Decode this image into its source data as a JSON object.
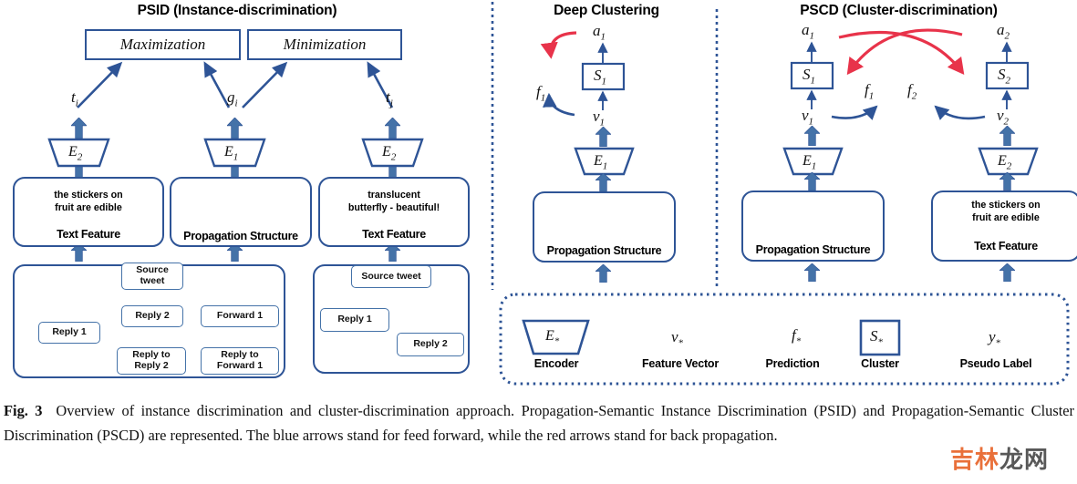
{
  "figure": {
    "number": "Fig. 3",
    "caption": "Overview of instance discrimination and cluster-discrimination approach. Propagation-Semantic Instance Discrimination (PSID) and Propagation-Semantic Cluster Discrimination (PSCD) are represented. The blue arrows stand for feed forward, while the red arrows stand for back propagation.",
    "watermark": {
      "orange": "吉林",
      "gray": "龙网"
    }
  },
  "colors": {
    "blue": "#2e5496",
    "blue_arrow": "#4472a8",
    "green_arrow": "#9bc987",
    "node_green": "#c6dfb0",
    "red": "#e8334a",
    "bubble_pink": "#e8607f",
    "text": "#111111"
  },
  "panels": {
    "psid": {
      "title": "PSID (Instance-discrimination)",
      "objectives": [
        {
          "label": "Maximization"
        },
        {
          "label": "Minimization"
        }
      ],
      "vectors": [
        {
          "sym": "t",
          "sub": "i"
        },
        {
          "sym": "g",
          "sub": "i"
        },
        {
          "sym": "t",
          "sub": "j"
        }
      ],
      "encoders": [
        {
          "sym": "E",
          "sub": "2"
        },
        {
          "sym": "E",
          "sub": "1"
        },
        {
          "sym": "E",
          "sub": "2"
        }
      ],
      "features": [
        {
          "kind": "text",
          "label": "Text Feature",
          "bubble": [
            "the stickers on",
            "fruit are edible"
          ]
        },
        {
          "kind": "graph",
          "label": "Propagation Structure"
        },
        {
          "kind": "text",
          "label": "Text Feature",
          "bubble": [
            "translucent",
            "butterfly - beautiful!"
          ]
        }
      ],
      "tree_left": {
        "nodes": [
          {
            "text": "Source\ntweet"
          },
          {
            "text": "Reply 1"
          },
          {
            "text": "Reply 2"
          },
          {
            "text": "Forward 1"
          },
          {
            "text": "Reply to\nReply 2"
          },
          {
            "text": "Reply to\nForward 1"
          }
        ]
      },
      "tree_right": {
        "nodes": [
          {
            "text": "Source tweet"
          },
          {
            "text": "Reply 1"
          },
          {
            "text": "Reply 2"
          }
        ]
      }
    },
    "deep_clustering": {
      "title": "Deep Clustering",
      "pseudo_label": {
        "sym": "a",
        "sub": "1"
      },
      "cluster": {
        "sym": "S",
        "sub": "1"
      },
      "prediction": {
        "sym": "f",
        "sub": "1"
      },
      "feature_vector": {
        "sym": "v",
        "sub": "1"
      },
      "encoder": {
        "sym": "E",
        "sub": "1"
      },
      "feature_label": "Propagation Structure"
    },
    "pscd": {
      "title": "PSCD (Cluster-discrimination)",
      "branches": [
        {
          "pseudo_label": {
            "sym": "a",
            "sub": "1"
          },
          "cluster": {
            "sym": "S",
            "sub": "1"
          },
          "prediction": {
            "sym": "f",
            "sub": "1"
          },
          "feature_vector": {
            "sym": "v",
            "sub": "1"
          },
          "encoder": {
            "sym": "E",
            "sub": "1"
          },
          "feature_kind": "graph",
          "feature_label": "Propagation Structure"
        },
        {
          "pseudo_label": {
            "sym": "a",
            "sub": "2"
          },
          "cluster": {
            "sym": "S",
            "sub": "2"
          },
          "prediction": {
            "sym": "f",
            "sub": "2"
          },
          "feature_vector": {
            "sym": "v",
            "sub": "2"
          },
          "encoder": {
            "sym": "E",
            "sub": "2"
          },
          "feature_kind": "text",
          "feature_label": "Text Feature",
          "bubble": [
            "the stickers on",
            "fruit are edible"
          ]
        }
      ]
    },
    "legend": {
      "items": [
        {
          "glyph": "E",
          "sub": "*",
          "shape": "trapezoid",
          "label": "Encoder"
        },
        {
          "glyph": "v",
          "sub": "*",
          "shape": "plain",
          "label": "Feature Vector"
        },
        {
          "glyph": "f",
          "sub": "*",
          "shape": "plain",
          "label": "Prediction"
        },
        {
          "glyph": "S",
          "sub": "*",
          "shape": "square",
          "label": "Cluster"
        },
        {
          "glyph": "y",
          "sub": "*",
          "shape": "plain",
          "label": "Pseudo Label"
        }
      ]
    }
  }
}
